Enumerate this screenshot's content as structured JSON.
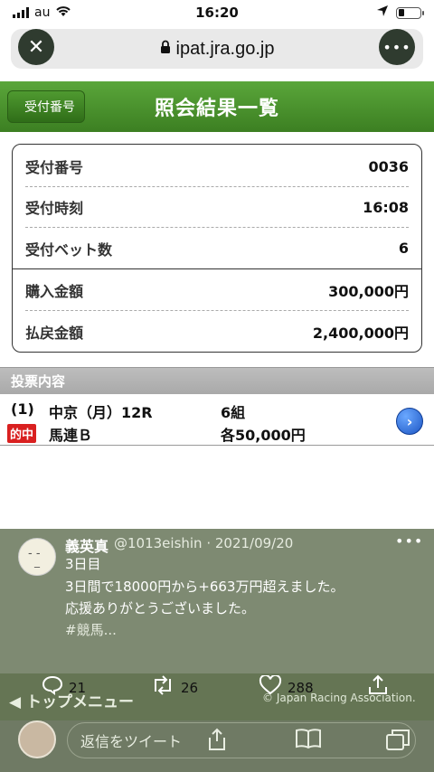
{
  "status": {
    "carrier": "au",
    "time": "16:20"
  },
  "browser": {
    "domain": "ipat.jra.go.jp"
  },
  "header": {
    "back_label": "受付番号",
    "title": "照会結果一覧"
  },
  "receipt": {
    "rows": [
      {
        "label": "受付番号",
        "value": "0036"
      },
      {
        "label": "受付時刻",
        "value": "16:08"
      },
      {
        "label": "受付ベット数",
        "value": "6"
      },
      {
        "label": "購入金額",
        "value": "300,000円"
      },
      {
        "label": "払戻金額",
        "value": "2,400,000円"
      }
    ]
  },
  "section": {
    "title": "投票内容"
  },
  "bet": {
    "number": "(1)",
    "race": "中京（月）12R",
    "combos": "6組",
    "hit_badge": "的中",
    "type": "馬連Ｂ",
    "amount": "各50,000円"
  },
  "tweet": {
    "name": "義英真",
    "handle": "@1013eishin · 2021/09/20",
    "lines": [
      "3日目",
      "3日間で18000円から+663万円超えました。",
      "応援ありがとうございました。",
      "#競馬..."
    ],
    "replies": "21",
    "retweets": "26",
    "likes": "288"
  },
  "footer": {
    "top_menu": "トップメニュー",
    "copyright": "© Japan Racing Association."
  },
  "reply_bar": {
    "placeholder": "返信をツイート"
  },
  "colors": {
    "header_green": "#3c7f22",
    "hit_red": "#d92020",
    "overlay": "#7e8a72"
  }
}
